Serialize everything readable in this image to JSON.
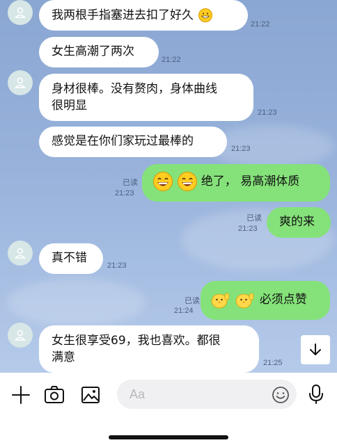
{
  "messages": [
    {
      "text": "我两根手指塞进去扣了好久",
      "emoji": "grinning-face",
      "time": "21:22"
    },
    {
      "text": "女生高潮了两次",
      "time": "21:22"
    },
    {
      "text_line1": "身材很棒。没有赘肉，身体曲线",
      "text_line2": "很明显",
      "time": "21:23"
    },
    {
      "text": "感觉是在你们家玩过最棒的",
      "time": "21:23"
    },
    {
      "emoji": "laughing-face",
      "text": "绝了，  易高潮体质",
      "read": "已读",
      "time": "21:23"
    },
    {
      "text": "爽的来",
      "read": "已读",
      "time": "21:23"
    },
    {
      "text": "真不错",
      "time": "21:23"
    },
    {
      "emoji": "thumbs-up-chick",
      "text": "必须点赞",
      "read": "已读",
      "time": "21:24"
    },
    {
      "text_line1": "女生很享受69，我也喜欢。都很",
      "text_line2": "满意",
      "time": "21:25"
    }
  ],
  "composer": {
    "placeholder": "Aa"
  },
  "icons": [
    "person-icon",
    "plus-icon",
    "camera-icon",
    "image-icon",
    "smiley-icon",
    "microphone-icon",
    "arrow-down-icon"
  ],
  "colors": {
    "background_top": "#8aa6d2",
    "incoming_bubble": "#ffffff",
    "outgoing_bubble": "#85e27a"
  }
}
